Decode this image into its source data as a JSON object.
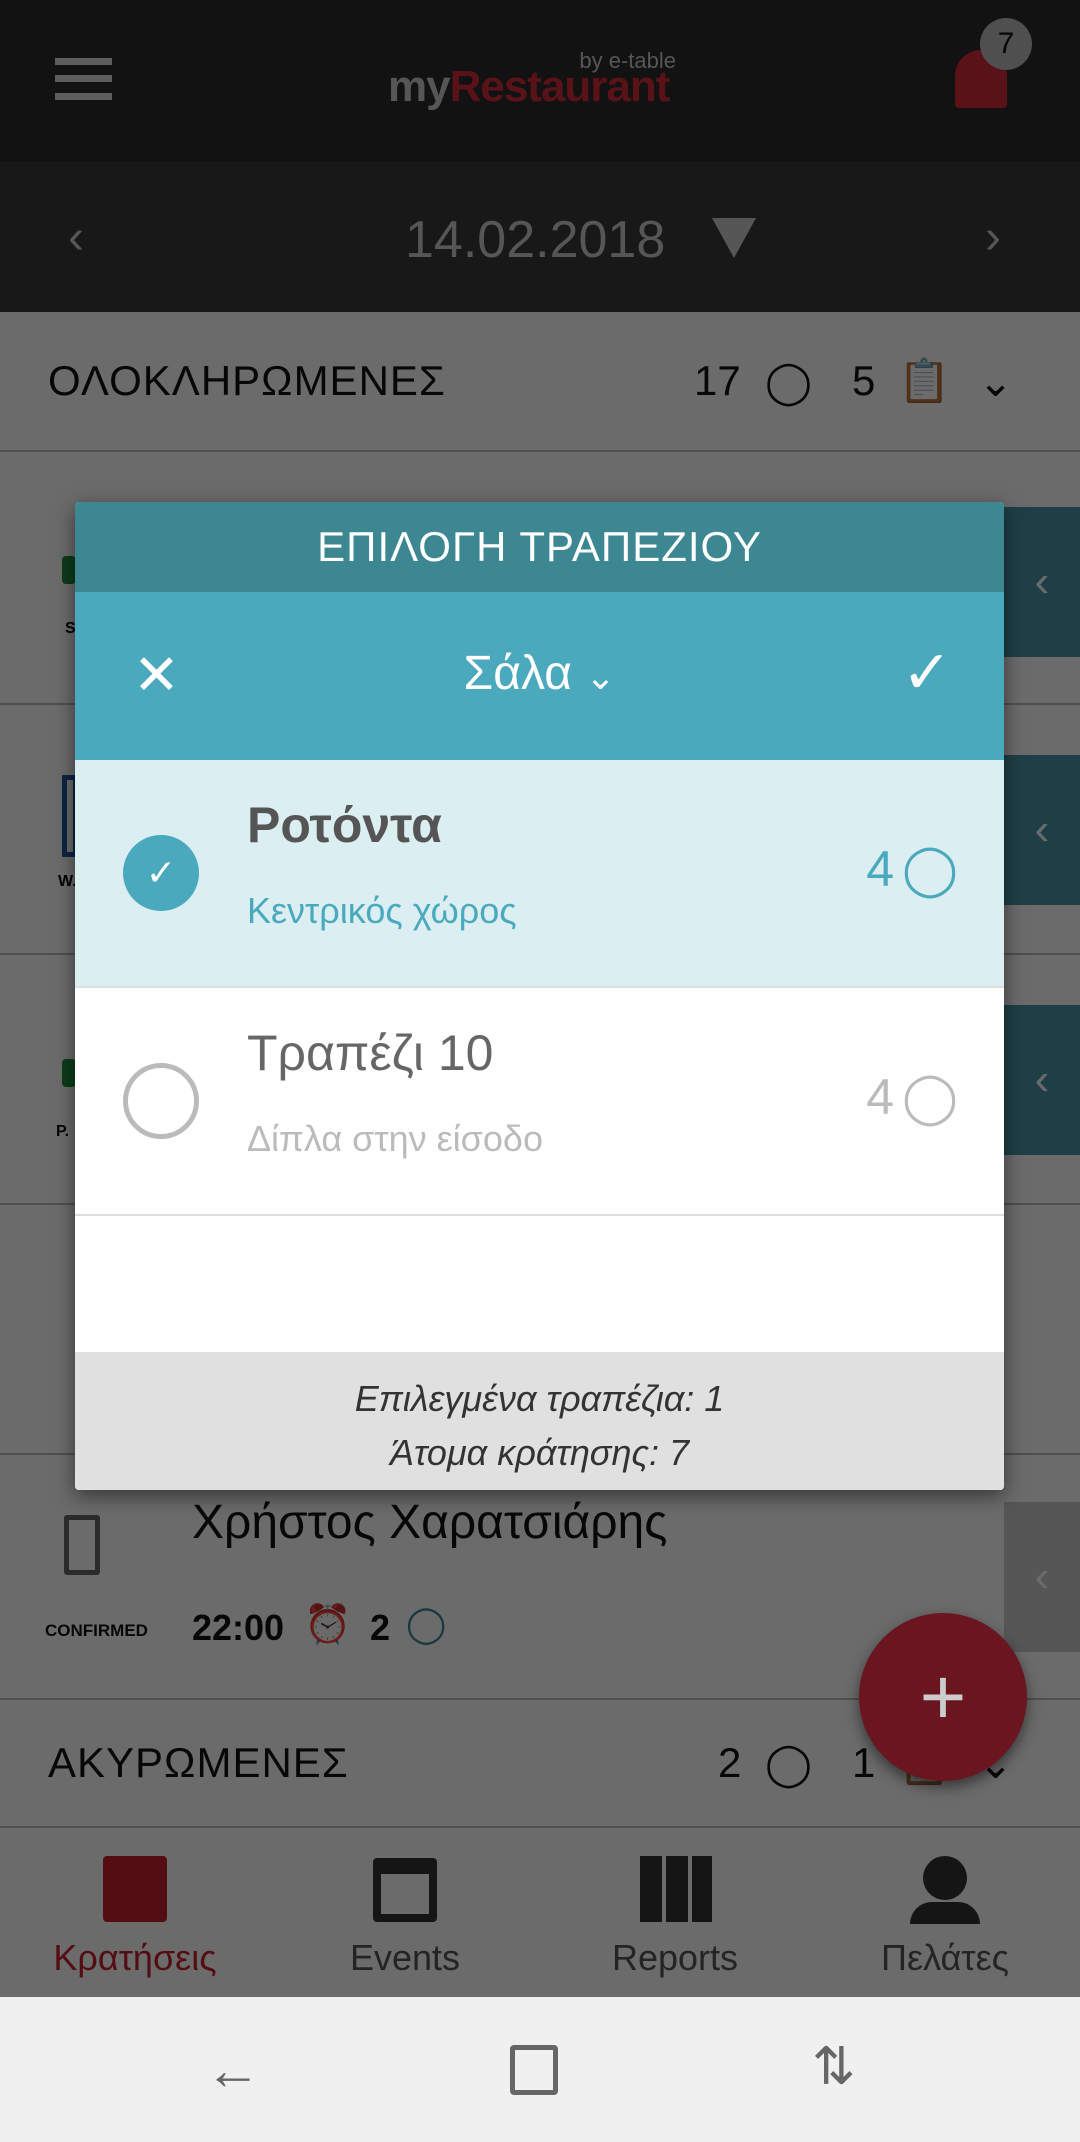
{
  "header": {
    "logo_my": "my",
    "logo_restaurant": "Restaurant",
    "logo_by": "by e-table",
    "notification_count": "7"
  },
  "datebar": {
    "date": "14.02.2018"
  },
  "sections": {
    "completed": {
      "title": "ΟΛΟΚΛΗΡΩΜΕΝΕΣ",
      "people": "17",
      "reservations": "5"
    },
    "cancelled": {
      "title": "ΑΚΥΡΩΜΕΝΕΣ",
      "people": "2",
      "reservations": "1"
    }
  },
  "rows": [
    {
      "status_partial": "S"
    },
    {
      "status_partial": "W."
    },
    {
      "status_partial": "P."
    }
  ],
  "reservation": {
    "name": "Χρήστος Χαρατσιάρης",
    "status": "CONFIRMED",
    "time": "22:00",
    "people": "2"
  },
  "modal": {
    "title": "ΕΠΙΛΟΓΗ ΤΡΑΠΕΖΙΟΥ",
    "area": "Σάλα",
    "tables": [
      {
        "name": "Ροτόντα",
        "description": "Κεντρικός χώρος",
        "capacity": "4",
        "selected": true
      },
      {
        "name": "Τραπέζι 10",
        "description": "Δίπλα στην είσοδο",
        "capacity": "4",
        "selected": false
      }
    ],
    "footer_selected": "Επιλεγμένα τραπέζια: 1",
    "footer_people": "Άτομα κράτησης: 7"
  },
  "bottom_nav": [
    {
      "label": "Κρατήσεις",
      "active": true
    },
    {
      "label": "Events"
    },
    {
      "label": "Reports"
    },
    {
      "label": "Πελάτες"
    }
  ],
  "colors": {
    "brand_red": "#b2232f",
    "teal": "#4aa9bc",
    "teal_dark": "#3d8793"
  }
}
